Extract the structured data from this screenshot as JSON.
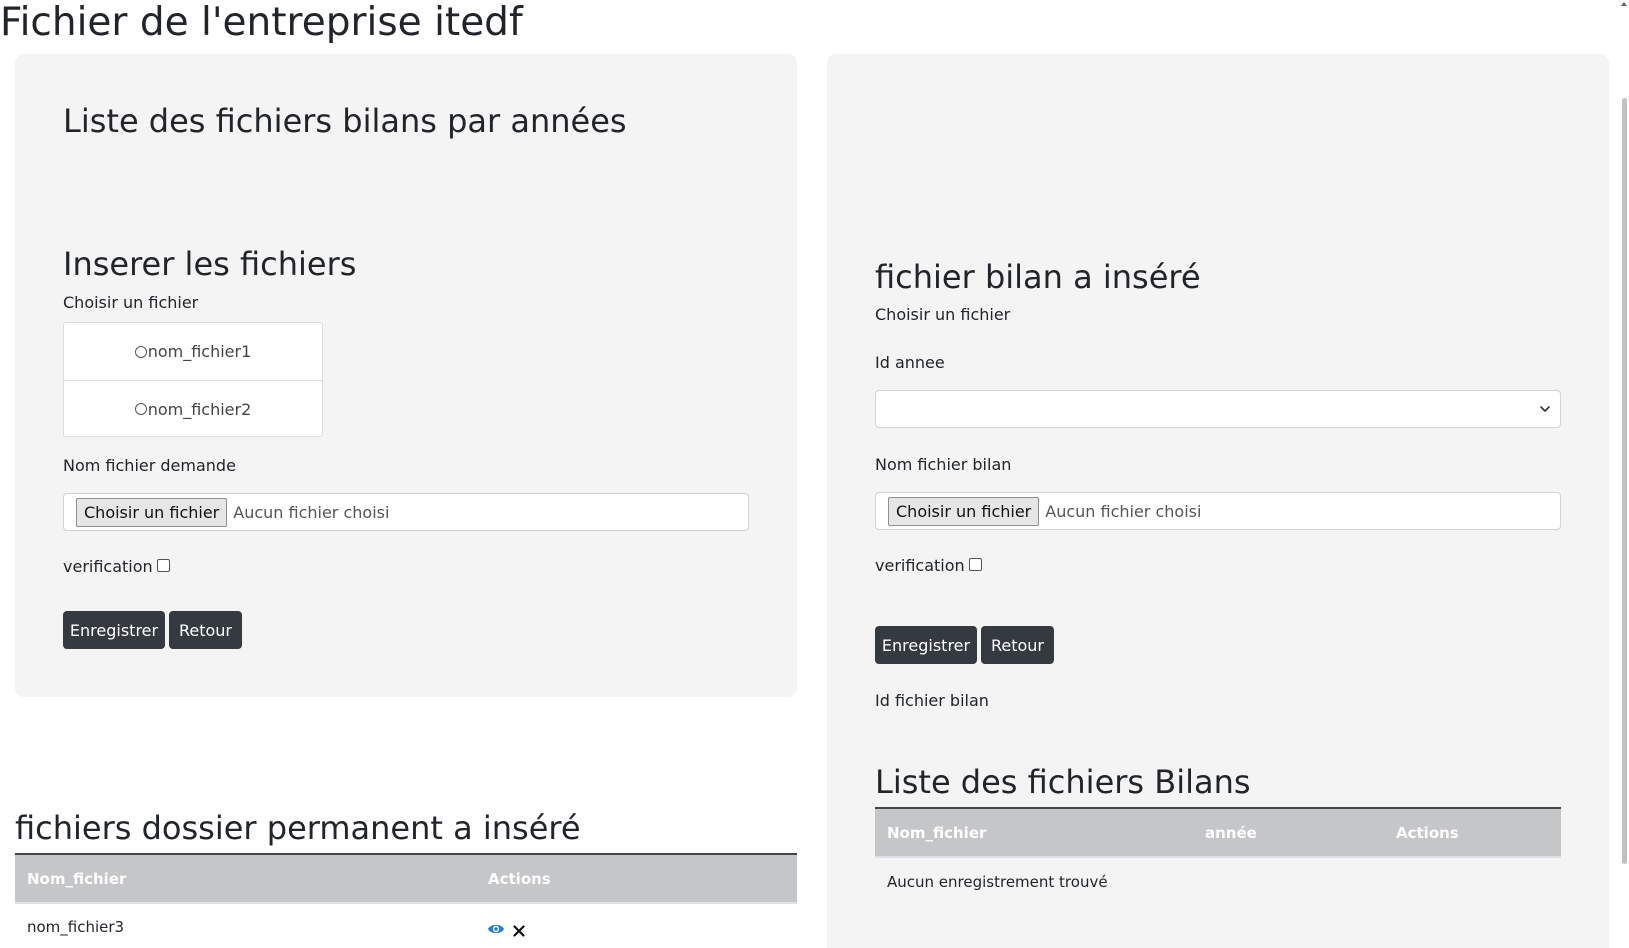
{
  "page": {
    "title": "Fichier de l'entreprise itedf"
  },
  "left_card": {
    "heading": "Liste des fichiers bilans par années",
    "insert_heading": "Inserer les fichiers",
    "choose_label": "Choisir un fichier",
    "radio_options": [
      "nom_fichier1",
      "nom_fichier2"
    ],
    "nom_fichier_label": "Nom fichier demande",
    "file_button": "Choisir un fichier",
    "file_status": "Aucun fichier choisi",
    "verification_label": "verification",
    "save_button": "Enregistrer",
    "back_button": "Retour"
  },
  "permanent_table": {
    "heading": "fichiers dossier permanent a inséré",
    "columns": [
      "Nom_fichier",
      "Actions"
    ],
    "rows": [
      {
        "nom_fichier": "nom_fichier3",
        "actions": [
          "eye-icon",
          "close-icon"
        ]
      }
    ]
  },
  "right_card": {
    "heading": "fichier bilan a inséré",
    "choose_label": "Choisir un fichier",
    "id_annee_label": "Id annee",
    "id_annee_value": "",
    "nom_fichier_label": "Nom fichier bilan",
    "file_button": "Choisir un fichier",
    "file_status": "Aucun fichier choisi",
    "verification_label": "verification",
    "save_button": "Enregistrer",
    "back_button": "Retour",
    "id_fichier_label": "Id fichier bilan",
    "list_heading": "Liste des fichiers Bilans",
    "columns": [
      "Nom_fichier",
      "année",
      "Actions"
    ],
    "empty_message": "Aucun enregistrement trouvé"
  },
  "colors": {
    "card_bg": "#f4f4f4",
    "button_dark": "#343a40",
    "table_header": "#c5c6c8",
    "eye_icon": "#1f7ad6"
  }
}
